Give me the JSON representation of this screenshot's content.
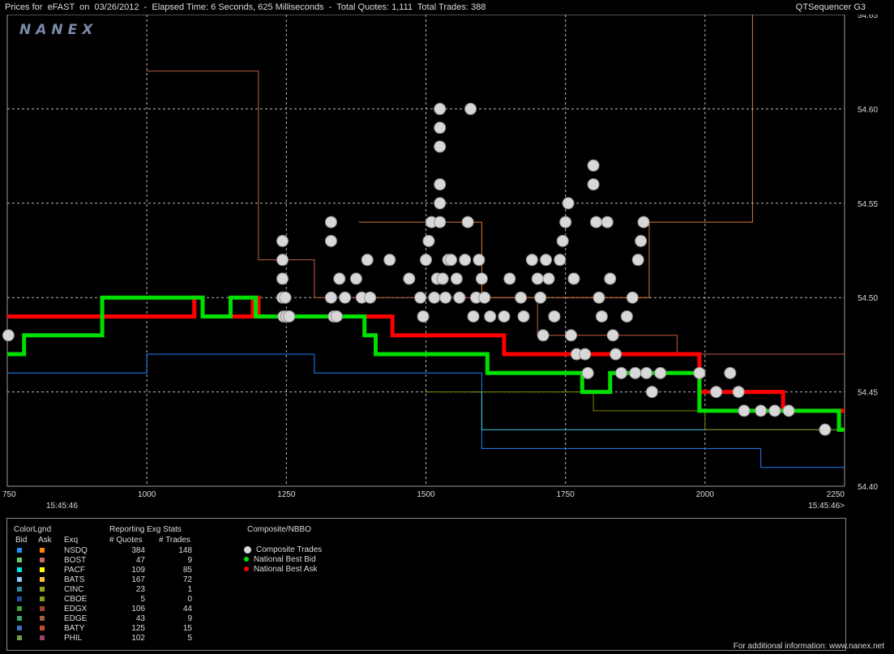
{
  "window": {
    "title": "Prices for  eFAST  on  03/26/2012  -  Elapsed Time: 6 Seconds, 625 Milliseconds  -  Total Quotes: 1,111  Total Trades: 388",
    "app_name": "QTSequencer G3",
    "watermark": "NANEX"
  },
  "chart_data": {
    "type": "line",
    "xlim": [
      750,
      2250
    ],
    "ylim": [
      54.4,
      54.65
    ],
    "x_ticks": [
      750,
      1000,
      1250,
      1500,
      1750,
      2000,
      2250
    ],
    "y_ticks": [
      54.4,
      54.45,
      54.5,
      54.55,
      54.6,
      54.65
    ],
    "x_time_left": "15:45:46",
    "x_time_right": "15:45:46>",
    "grid": true,
    "nbb": {
      "name": "National Best Bid",
      "color": "#00e000",
      "points": [
        [
          750,
          54.47
        ],
        [
          780,
          54.47
        ],
        [
          780,
          54.48
        ],
        [
          920,
          54.48
        ],
        [
          920,
          54.5
        ],
        [
          1100,
          54.5
        ],
        [
          1100,
          54.49
        ],
        [
          1150,
          54.49
        ],
        [
          1150,
          54.5
        ],
        [
          1195,
          54.5
        ],
        [
          1195,
          54.49
        ],
        [
          1390,
          54.49
        ],
        [
          1390,
          54.48
        ],
        [
          1410,
          54.48
        ],
        [
          1410,
          54.47
        ],
        [
          1490,
          54.47
        ],
        [
          1590,
          54.47
        ],
        [
          1610,
          54.47
        ],
        [
          1610,
          54.46
        ],
        [
          1780,
          54.46
        ],
        [
          1780,
          54.45
        ],
        [
          1830,
          54.45
        ],
        [
          1830,
          54.46
        ],
        [
          1990,
          54.46
        ],
        [
          1990,
          54.44
        ],
        [
          2240,
          54.44
        ],
        [
          2240,
          54.43
        ],
        [
          2250,
          54.43
        ]
      ]
    },
    "nbo": {
      "name": "National Best Ask",
      "color": "#ff0000",
      "points": [
        [
          750,
          54.49
        ],
        [
          1085,
          54.49
        ],
        [
          1085,
          54.5
        ],
        [
          1100,
          54.5
        ],
        [
          1100,
          54.49
        ],
        [
          1190,
          54.49
        ],
        [
          1190,
          54.5
        ],
        [
          1200,
          54.5
        ],
        [
          1200,
          54.49
        ],
        [
          1250,
          54.49
        ],
        [
          1390,
          54.49
        ],
        [
          1440,
          54.49
        ],
        [
          1440,
          54.48
        ],
        [
          1600,
          54.48
        ],
        [
          1640,
          54.48
        ],
        [
          1640,
          54.47
        ],
        [
          1790,
          54.47
        ],
        [
          1790,
          54.47
        ],
        [
          1990,
          54.47
        ],
        [
          1990,
          54.45
        ],
        [
          2140,
          54.45
        ],
        [
          2140,
          54.44
        ],
        [
          2240,
          54.44
        ],
        [
          2250,
          54.44
        ]
      ]
    },
    "trades": {
      "name": "Composite Trades",
      "color": "#d8d8d8",
      "points": [
        [
          752,
          54.48
        ],
        [
          1245,
          54.49
        ],
        [
          1250,
          54.49
        ],
        [
          1243,
          54.53
        ],
        [
          1243,
          54.52
        ],
        [
          1243,
          54.51
        ],
        [
          1243,
          54.5
        ],
        [
          1248,
          54.5
        ],
        [
          1255,
          54.49
        ],
        [
          1330,
          54.54
        ],
        [
          1330,
          54.53
        ],
        [
          1330,
          54.5
        ],
        [
          1335,
          54.49
        ],
        [
          1340,
          54.49
        ],
        [
          1345,
          54.51
        ],
        [
          1355,
          54.5
        ],
        [
          1375,
          54.51
        ],
        [
          1385,
          54.5
        ],
        [
          1395,
          54.52
        ],
        [
          1400,
          54.5
        ],
        [
          1435,
          54.52
        ],
        [
          1470,
          54.51
        ],
        [
          1490,
          54.5
        ],
        [
          1495,
          54.49
        ],
        [
          1500,
          54.52
        ],
        [
          1505,
          54.53
        ],
        [
          1510,
          54.54
        ],
        [
          1515,
          54.5
        ],
        [
          1520,
          54.51
        ],
        [
          1525,
          54.6
        ],
        [
          1525,
          54.59
        ],
        [
          1525,
          54.58
        ],
        [
          1525,
          54.56
        ],
        [
          1525,
          54.55
        ],
        [
          1525,
          54.54
        ],
        [
          1530,
          54.51
        ],
        [
          1535,
          54.5
        ],
        [
          1540,
          54.52
        ],
        [
          1545,
          54.52
        ],
        [
          1555,
          54.51
        ],
        [
          1560,
          54.5
        ],
        [
          1570,
          54.52
        ],
        [
          1575,
          54.54
        ],
        [
          1580,
          54.6
        ],
        [
          1585,
          54.49
        ],
        [
          1590,
          54.5
        ],
        [
          1595,
          54.52
        ],
        [
          1600,
          54.51
        ],
        [
          1605,
          54.5
        ],
        [
          1615,
          54.49
        ],
        [
          1640,
          54.49
        ],
        [
          1650,
          54.51
        ],
        [
          1670,
          54.5
        ],
        [
          1675,
          54.49
        ],
        [
          1690,
          54.52
        ],
        [
          1700,
          54.51
        ],
        [
          1705,
          54.5
        ],
        [
          1710,
          54.48
        ],
        [
          1715,
          54.52
        ],
        [
          1720,
          54.51
        ],
        [
          1730,
          54.49
        ],
        [
          1740,
          54.52
        ],
        [
          1745,
          54.53
        ],
        [
          1750,
          54.54
        ],
        [
          1755,
          54.55
        ],
        [
          1760,
          54.48
        ],
        [
          1765,
          54.51
        ],
        [
          1770,
          54.47
        ],
        [
          1785,
          54.47
        ],
        [
          1790,
          54.46
        ],
        [
          1800,
          54.57
        ],
        [
          1800,
          54.56
        ],
        [
          1805,
          54.54
        ],
        [
          1810,
          54.5
        ],
        [
          1815,
          54.49
        ],
        [
          1825,
          54.54
        ],
        [
          1830,
          54.51
        ],
        [
          1835,
          54.48
        ],
        [
          1840,
          54.47
        ],
        [
          1850,
          54.46
        ],
        [
          1860,
          54.49
        ],
        [
          1870,
          54.5
        ],
        [
          1875,
          54.46
        ],
        [
          1880,
          54.52
        ],
        [
          1885,
          54.53
        ],
        [
          1890,
          54.54
        ],
        [
          1895,
          54.46
        ],
        [
          1905,
          54.45
        ],
        [
          1920,
          54.46
        ],
        [
          1990,
          54.46
        ],
        [
          2020,
          54.45
        ],
        [
          2045,
          54.46
        ],
        [
          2060,
          54.45
        ],
        [
          2070,
          54.44
        ],
        [
          2100,
          54.44
        ],
        [
          2125,
          54.44
        ],
        [
          2150,
          54.44
        ],
        [
          2215,
          54.43
        ]
      ]
    },
    "exchange_bids": [
      {
        "color": "#2080ff",
        "points": [
          [
            750,
            54.46
          ],
          [
            1000,
            54.46
          ],
          [
            1000,
            54.47
          ],
          [
            1300,
            54.47
          ],
          [
            1300,
            54.46
          ],
          [
            1600,
            54.46
          ],
          [
            1600,
            54.42
          ],
          [
            1850,
            54.42
          ],
          [
            2100,
            54.42
          ],
          [
            2100,
            54.41
          ],
          [
            2250,
            54.41
          ]
        ]
      },
      {
        "color": "#40c8e0",
        "points": [
          [
            1580,
            54.45
          ],
          [
            1600,
            54.45
          ],
          [
            1600,
            54.43
          ],
          [
            2250,
            54.43
          ]
        ]
      },
      {
        "color": "#808000",
        "points": [
          [
            1500,
            54.45
          ],
          [
            1800,
            54.45
          ],
          [
            1800,
            54.44
          ],
          [
            2000,
            54.44
          ],
          [
            2000,
            54.43
          ],
          [
            2250,
            54.43
          ]
        ]
      }
    ],
    "exchange_asks": [
      {
        "color": "#e07830",
        "points": [
          [
            1380,
            54.54
          ],
          [
            1600,
            54.54
          ],
          [
            1600,
            54.5
          ],
          [
            1900,
            54.5
          ],
          [
            1900,
            54.54
          ],
          [
            2085,
            54.54
          ],
          [
            2085,
            54.65
          ]
        ]
      },
      {
        "color": "#c06040",
        "points": [
          [
            1000,
            54.62
          ],
          [
            1200,
            54.62
          ],
          [
            1200,
            54.52
          ],
          [
            1300,
            54.52
          ],
          [
            1300,
            54.5
          ],
          [
            1700,
            54.5
          ],
          [
            1700,
            54.48
          ],
          [
            1950,
            54.48
          ],
          [
            1950,
            54.47
          ],
          [
            2250,
            54.47
          ]
        ]
      }
    ]
  },
  "legend": {
    "colorlgnd": "ColorLgnd",
    "col_bid": "Bid",
    "col_ask": "Ask",
    "col_exq": "Exq",
    "stats_title": "Reporting Exg Stats",
    "col_quotes": "# Quotes",
    "col_trades": "# Trades",
    "rows": [
      {
        "exq": "NSDQ",
        "quotes": "384",
        "trades": "148",
        "bid": "#1e90ff",
        "ask": "#ff8c00"
      },
      {
        "exq": "BOST",
        "quotes": "47",
        "trades": "9",
        "bid": "#66cc66",
        "ask": "#cc6666"
      },
      {
        "exq": "PACF",
        "quotes": "109",
        "trades": "85",
        "bid": "#00e5ee",
        "ask": "#ffff00"
      },
      {
        "exq": "BATS",
        "quotes": "167",
        "trades": "72",
        "bid": "#87cefa",
        "ask": "#ffc040"
      },
      {
        "exq": "CINC",
        "quotes": "23",
        "trades": "1",
        "bid": "#2f8fa0",
        "ask": "#a0a020"
      },
      {
        "exq": "CBOE",
        "quotes": "5",
        "trades": "0",
        "bid": "#1e4fa0",
        "ask": "#80a020"
      },
      {
        "exq": "EDGX",
        "quotes": "106",
        "trades": "44",
        "bid": "#3ca03c",
        "ask": "#a04030"
      },
      {
        "exq": "EDGE",
        "quotes": "43",
        "trades": "9",
        "bid": "#40a070",
        "ask": "#a06040"
      },
      {
        "exq": "BATY",
        "quotes": "125",
        "trades": "15",
        "bid": "#4070c0",
        "ask": "#c05030"
      },
      {
        "exq": "PHIL",
        "quotes": "102",
        "trades": "5",
        "bid": "#70a040",
        "ask": "#a04070"
      }
    ],
    "composite_title": "Composite/NBBO",
    "composite_trades": "Composite Trades",
    "national_best_bid": "National Best Bid",
    "national_best_ask": "National Best Ask"
  },
  "footer": "For additional information: www.nanex.net"
}
